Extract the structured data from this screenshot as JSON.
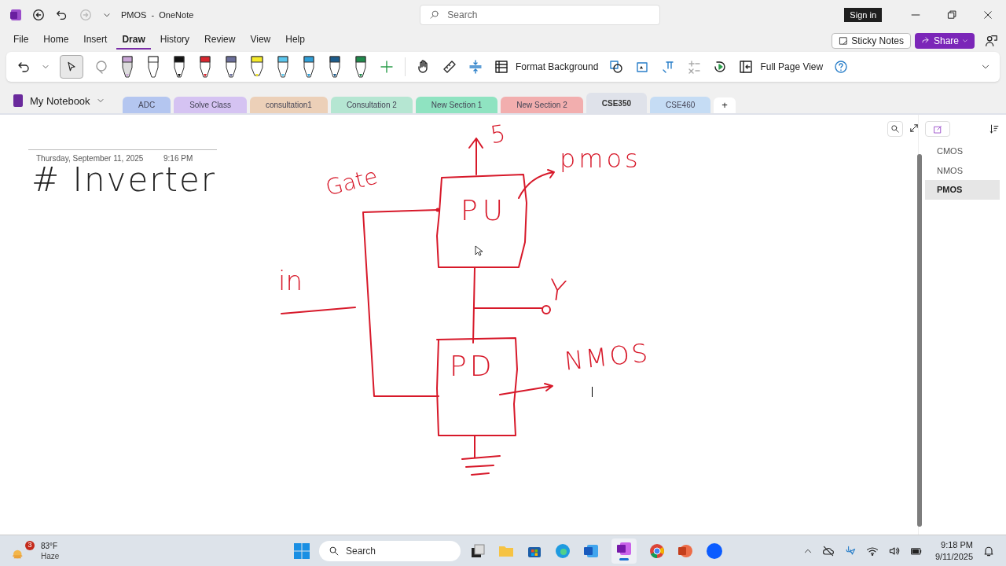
{
  "window": {
    "title": "PMOS  -  OneNote",
    "search_placeholder": "Search",
    "sign_in": "Sign in"
  },
  "menu": [
    {
      "label": "File",
      "selected": false
    },
    {
      "label": "Home",
      "selected": false
    },
    {
      "label": "Insert",
      "selected": false
    },
    {
      "label": "Draw",
      "selected": true
    },
    {
      "label": "History",
      "selected": false
    },
    {
      "label": "Review",
      "selected": false
    },
    {
      "label": "View",
      "selected": false
    },
    {
      "label": "Help",
      "selected": false
    }
  ],
  "header_buttons": {
    "sticky_notes": "Sticky Notes",
    "share": "Share"
  },
  "ribbon": {
    "format_background": "Format Background",
    "full_page_view": "Full Page View"
  },
  "notebook": "My Notebook",
  "sections": [
    {
      "label": "ADC",
      "color": "#b4c6f0",
      "selected": false
    },
    {
      "label": "Solve Class",
      "color": "#d5c3f2",
      "selected": false
    },
    {
      "label": "consultation1",
      "color": "#ecd0b8",
      "selected": false
    },
    {
      "label": "Consultation 2",
      "color": "#b5e6d2",
      "selected": false
    },
    {
      "label": "New Section 1",
      "color": "#8fe3c1",
      "selected": false
    },
    {
      "label": "New Section 2",
      "color": "#f2aeae",
      "selected": false
    },
    {
      "label": "CSE350",
      "color": "#dfe2ea",
      "selected": true
    },
    {
      "label": "CSE460",
      "color": "#c5dcf4",
      "selected": false
    }
  ],
  "add_section": "+",
  "page": {
    "date": "Thursday, September 11, 2025",
    "time": "9:16 PM",
    "title": "# Inverter",
    "ink_labels": [
      "5",
      "pmos",
      "Gate",
      "PU",
      "in",
      "Y",
      "PD",
      "NMOS"
    ]
  },
  "pages": [
    {
      "label": "CMOS",
      "selected": false
    },
    {
      "label": "NMOS",
      "selected": false
    },
    {
      "label": "PMOS",
      "selected": true
    }
  ],
  "taskbar": {
    "weather_badge": "3",
    "temperature": "83°F",
    "condition": "Haze",
    "search_placeholder": "Search",
    "time": "9:18 PM",
    "date": "9/11/2025"
  }
}
